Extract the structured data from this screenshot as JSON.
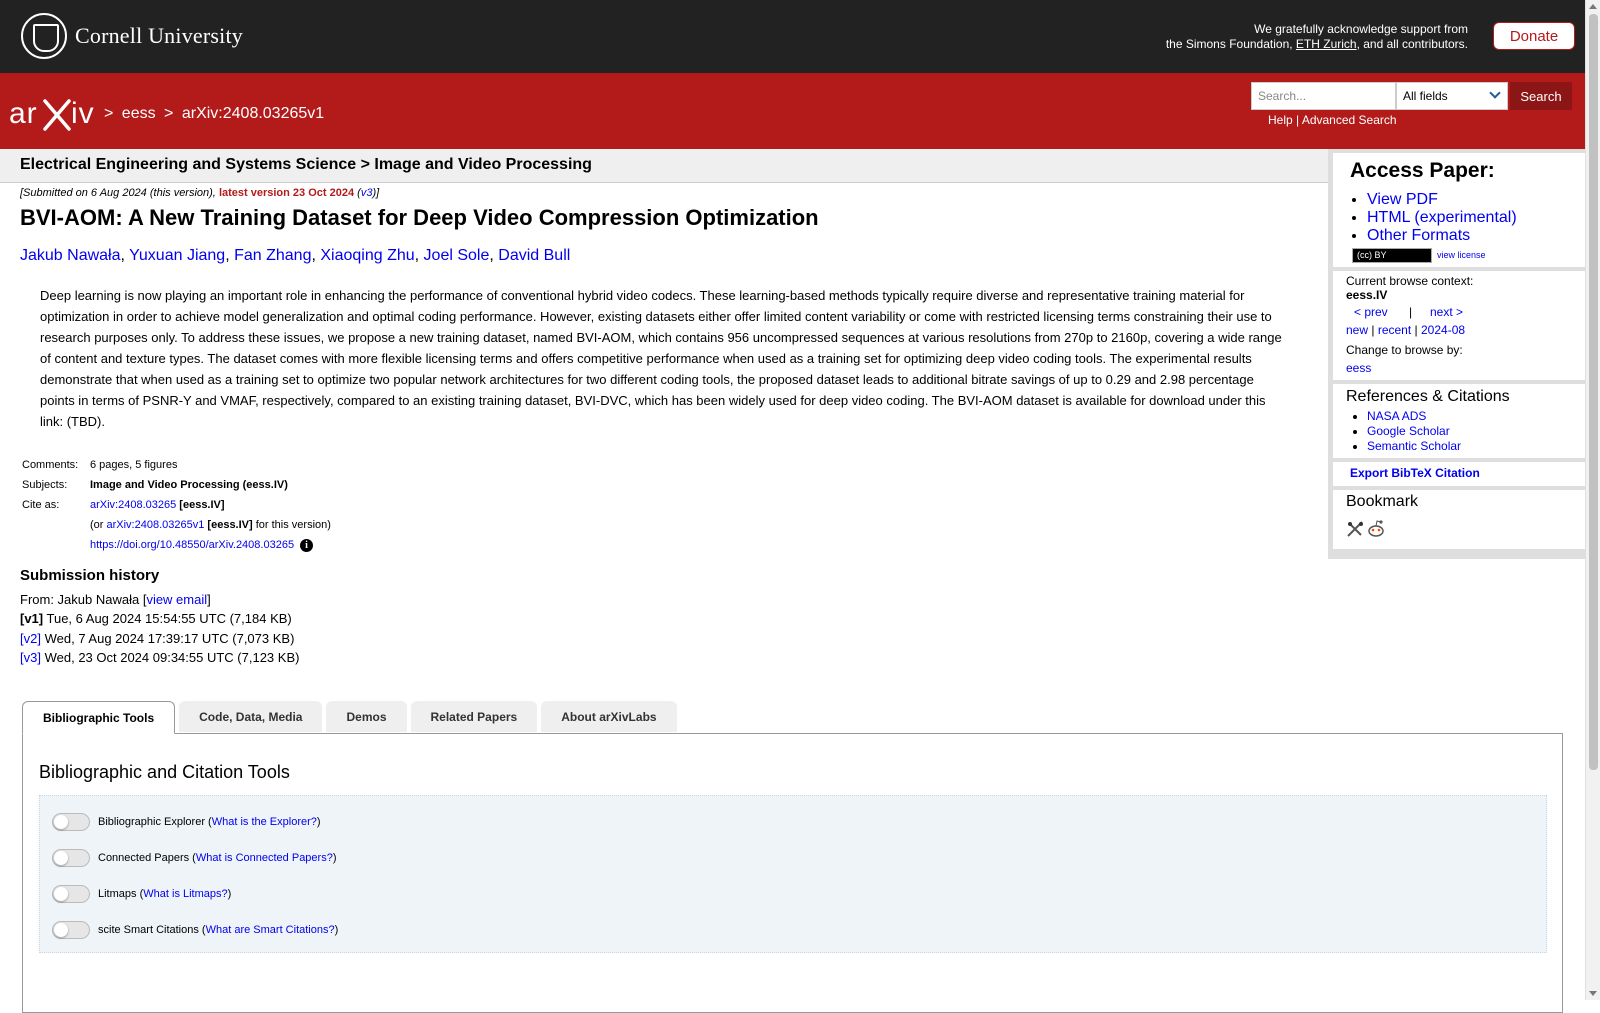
{
  "header": {
    "cornell_name": "Cornell University",
    "support_line1": "We gratefully acknowledge support from",
    "support_line2_pre": "the Simons Foundation, ",
    "support_link": "ETH Zurich",
    "support_line2_post": ", and all contributors.",
    "donate_label": "Donate"
  },
  "arxiv_bar": {
    "breadcrumb_sep": ">",
    "breadcrumb_category": "eess",
    "breadcrumb_id": "arXiv:2408.03265v1",
    "search_placeholder": "Search...",
    "search_field_selected": "All fields",
    "search_button": "Search",
    "help_link": "Help",
    "links_sep": " | ",
    "advanced_search_link": "Advanced Search"
  },
  "subheader": {
    "text": "Electrical Engineering and Systems Science > Image and Video Processing"
  },
  "paper": {
    "submitted_pre": "[Submitted on 6 Aug 2024 (this version), ",
    "latest_version": "latest version 23 Oct 2024",
    "v3_open": " (",
    "v3_link": "v3",
    "v3_close": ")]",
    "title": "BVI-AOM: A New Training Dataset for Deep Video Compression Optimization",
    "authors": [
      "Jakub Nawała",
      "Yuxuan Jiang",
      "Fan Zhang",
      "Xiaoqing Zhu",
      "Joel Sole",
      "David Bull"
    ],
    "abstract": "Deep learning is now playing an important role in enhancing the performance of conventional hybrid video codecs. These learning-based methods typically require diverse and representative training material for optimization in order to achieve model generalization and optimal coding performance. However, existing datasets either offer limited content variability or come with restricted licensing terms constraining their use to research purposes only. To address these issues, we propose a new training dataset, named BVI-AOM, which contains 956 uncompressed sequences at various resolutions from 270p to 2160p, covering a wide range of content and texture types. The dataset comes with more flexible licensing terms and offers competitive performance when used as a training set for optimizing deep video coding tools. The experimental results demonstrate that when used as a training set to optimize two popular network architectures for two different coding tools, the proposed dataset leads to additional bitrate savings of up to 0.29 and 2.98 percentage points in terms of PSNR-Y and VMAF, respectively, compared to an existing training dataset, BVI-DVC, which has been widely used for deep video coding. The BVI-AOM dataset is available for download under this link: (TBD)."
  },
  "metadata": {
    "comments_label": "Comments:",
    "comments_value": "6 pages, 5 figures",
    "subjects_label": "Subjects:",
    "subjects_value": "Image and Video Processing (eess.IV)",
    "cite_label": "Cite as:",
    "cite_link": "arXiv:2408.03265",
    "cite_cat": "[eess.IV]",
    "cite_or_pre": "(or ",
    "cite_v1_link": "arXiv:2408.03265v1",
    "cite_v1_cat": "[eess.IV]",
    "cite_v1_post": " for this version)",
    "doi_link": "https://doi.org/10.48550/arXiv.2408.03265",
    "info_icon_glyph": "i"
  },
  "history": {
    "heading": "Submission history",
    "from_pre": "From: Jakub Nawała [",
    "view_email": "view email",
    "from_post": "]",
    "versions": [
      {
        "label": "[v1]",
        "linked": false,
        "text": "Tue, 6 Aug 2024 15:54:55 UTC (7,184 KB)"
      },
      {
        "label": "[v2]",
        "linked": true,
        "text": "Wed, 7 Aug 2024 17:39:17 UTC (7,073 KB)"
      },
      {
        "label": "[v3]",
        "linked": true,
        "text": "Wed, 23 Oct 2024 09:34:55 UTC (7,123 KB)"
      }
    ]
  },
  "sidebar": {
    "access_heading": "Access Paper:",
    "access_links": [
      "View PDF",
      "HTML (experimental)",
      "Other Formats"
    ],
    "license_badge": "(cc) BY",
    "view_license": "view license",
    "browse_context_label": "Current browse context:",
    "browse_context_value": "eess.IV",
    "prev": "< prev",
    "pipe": "|",
    "next": "next >",
    "new": "new",
    "recent": "recent",
    "month": "2024-08",
    "change_browse_label": "Change to browse by:",
    "change_browse_value": "eess",
    "refs_heading": "References & Citations",
    "refs_links": [
      "NASA ADS",
      "Google Scholar",
      "Semantic Scholar"
    ],
    "export_bibtex": "Export BibTeX Citation",
    "bookmark_heading": "Bookmark"
  },
  "tabs": {
    "items": [
      "Bibliographic Tools",
      "Code, Data, Media",
      "Demos",
      "Related Papers",
      "About arXivLabs"
    ],
    "active": "Bibliographic Tools",
    "panel_title": "Bibliographic and Citation Tools",
    "tools": [
      {
        "name": "Bibliographic Explorer",
        "link": "What is the Explorer?"
      },
      {
        "name": "Connected Papers",
        "link": "What is Connected Papers?"
      },
      {
        "name": "Litmaps",
        "link": "What is Litmaps?"
      },
      {
        "name": "scite Smart Citations",
        "link": "What are Smart Citations?"
      }
    ]
  },
  "colors": {
    "arxiv_red": "#b31b1b",
    "cornell_dark": "#222222",
    "link_blue": "#0000ee",
    "tools_bg": "#eef4f8"
  }
}
